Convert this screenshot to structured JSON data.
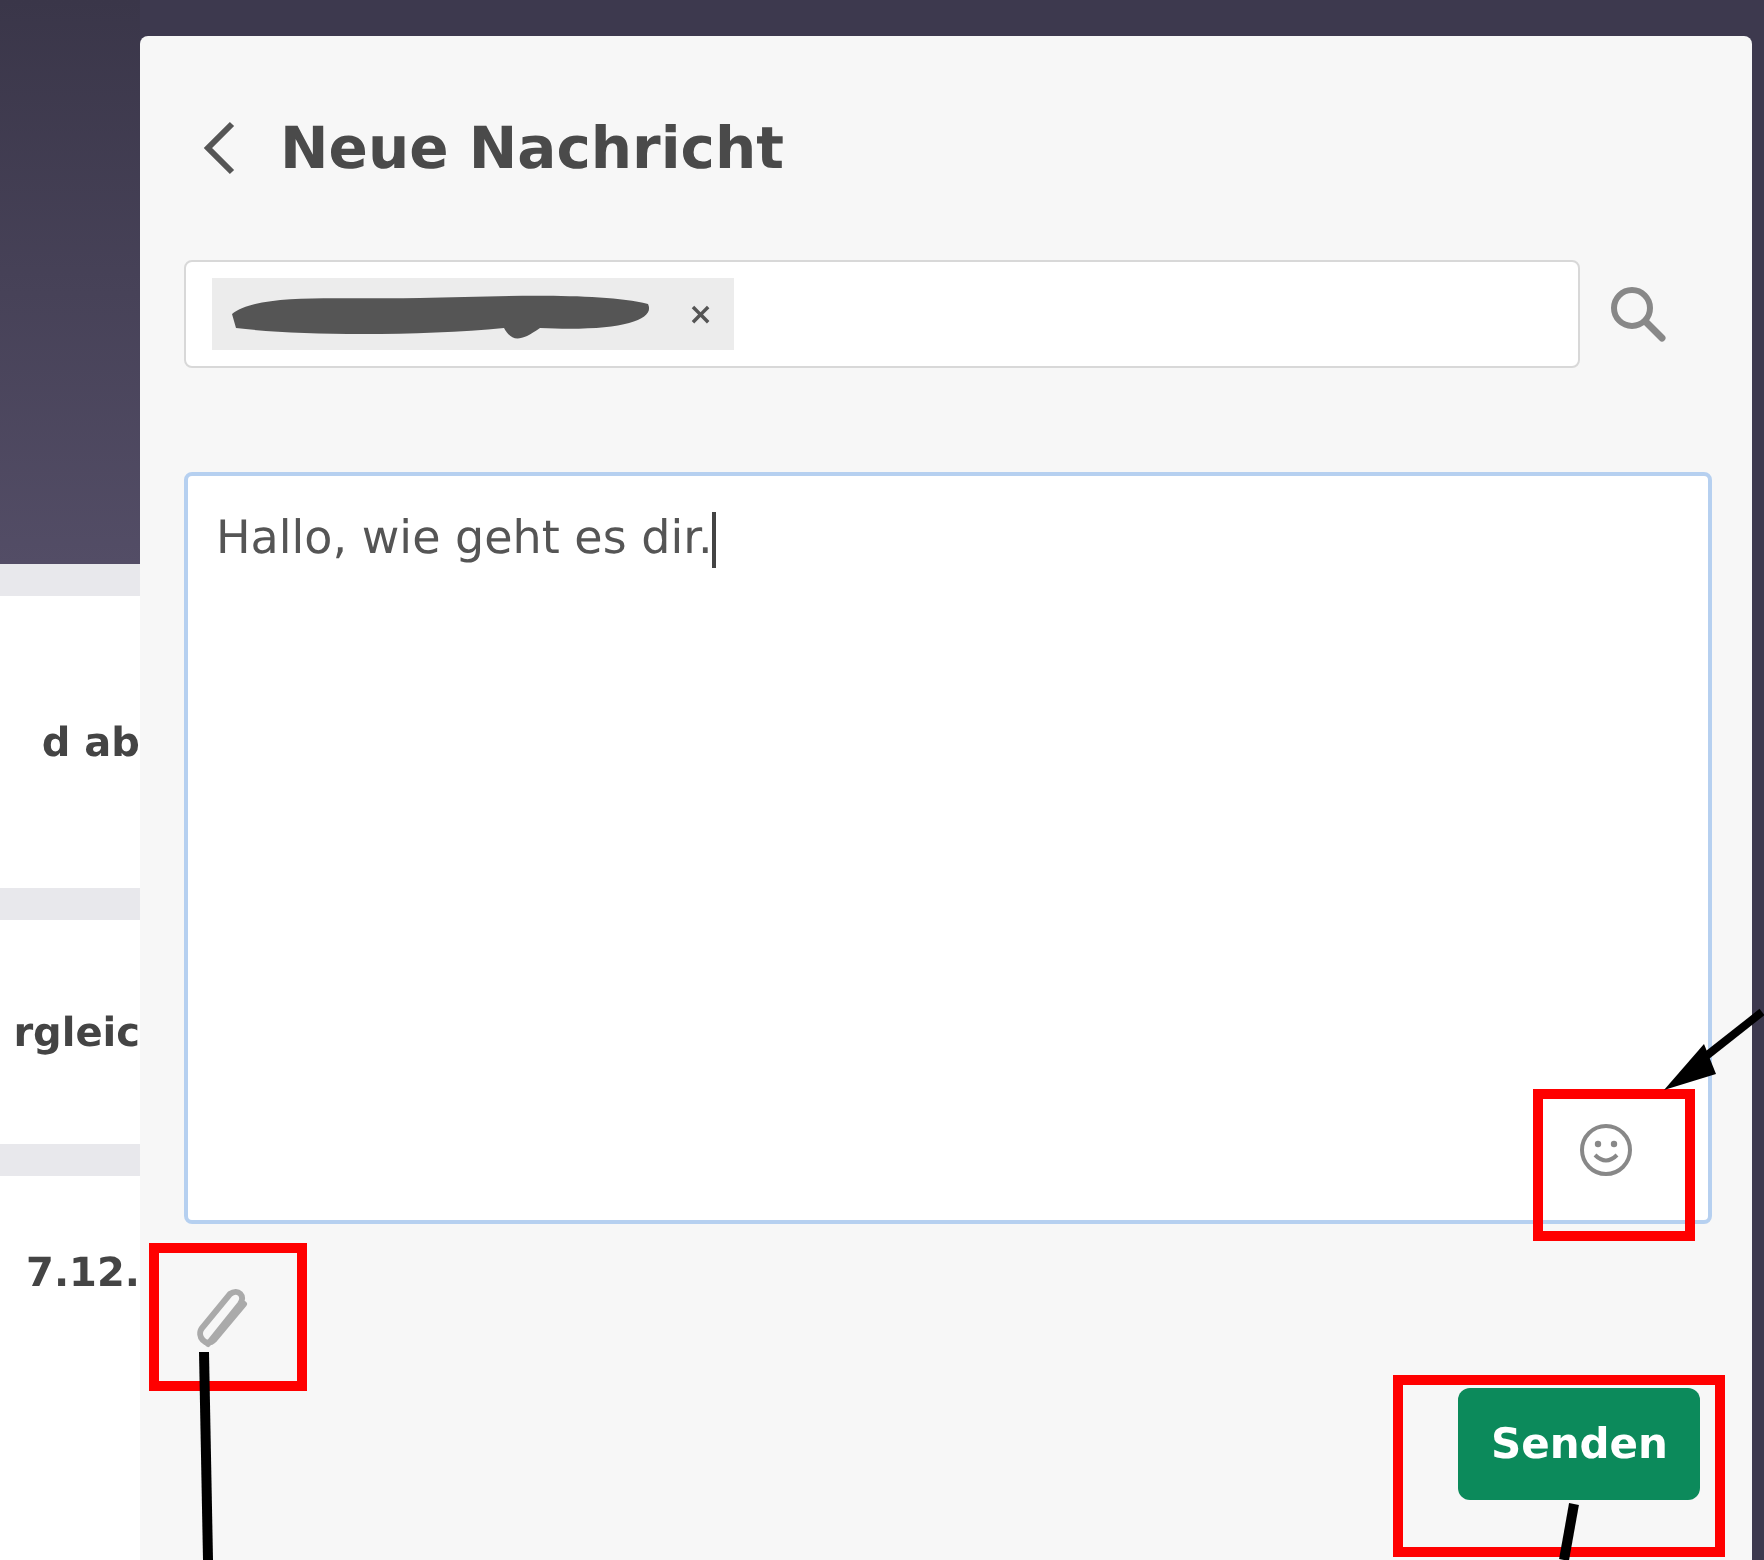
{
  "background_list": [
    {
      "text": "d ab"
    },
    {
      "text": "rgleic"
    },
    {
      "text": "7.12."
    }
  ],
  "dialog": {
    "title": "Neue Nachricht",
    "recipient_chip": {
      "remove": "×"
    },
    "message": "Hallo, wie geht es dir.",
    "send_button": "Senden"
  }
}
